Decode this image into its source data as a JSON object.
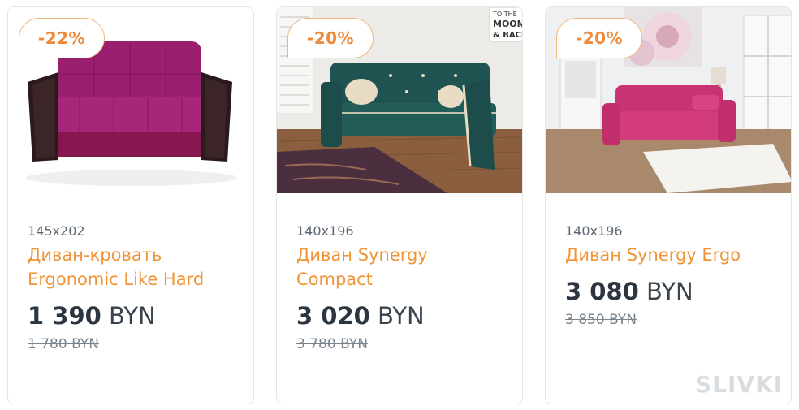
{
  "products": [
    {
      "discount": "-22%",
      "size": "145x202",
      "title": "Диван-кровать Ergonomic Like Hard",
      "price_amount": "1 390",
      "price_currency": "BYN",
      "old_price": "1 780 BYN",
      "image_description": "magenta sofa bed with dark wooden armrests on white background"
    },
    {
      "discount": "-20%",
      "size": "140x196",
      "title": "Диван Synergy Compact",
      "price_amount": "3 020",
      "price_currency": "BYN",
      "old_price": "3 780 BYN",
      "image_description": "dark teal sofa with beige piping in a living room",
      "wall_sign": [
        "TO THE",
        "MOON",
        "& BACK"
      ]
    },
    {
      "discount": "-20%",
      "size": "140x196",
      "title": "Диван Synergy Ergo",
      "price_amount": "3 080",
      "price_currency": "BYN",
      "old_price": "3 850 BYN",
      "image_description": "pink sofa in a bright room with white rug"
    }
  ],
  "watermark": "SLIVKI",
  "colors": {
    "accent": "#f09437",
    "badge_text": "#ee8a3a",
    "price": "#2c3640",
    "old_price": "#7a848d",
    "border": "#e6e6e6"
  }
}
